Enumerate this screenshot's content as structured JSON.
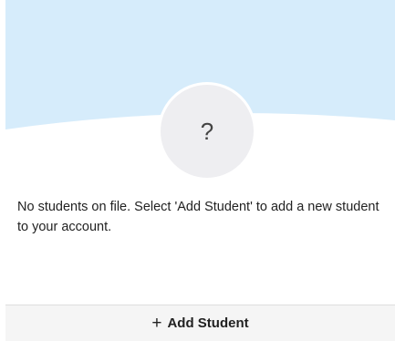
{
  "empty_state": {
    "avatar_glyph": "?",
    "message": "No students on file. Select 'Add Student' to add a new student to your account."
  },
  "footer": {
    "add_icon": "plus-icon",
    "add_glyph": "+",
    "add_label": "Add Student"
  },
  "colors": {
    "banner": "#d6ecfb",
    "avatar_bg": "#eeeef1",
    "footer_bg": "#f5f5f5"
  }
}
